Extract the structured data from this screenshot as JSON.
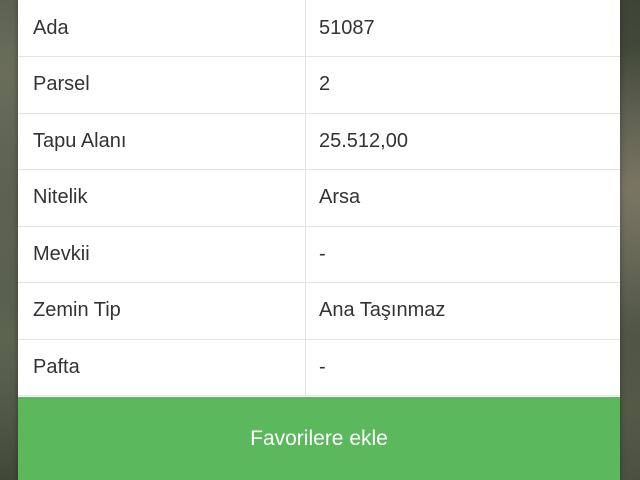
{
  "table": {
    "rows": [
      {
        "label": "Ada",
        "value": "51087"
      },
      {
        "label": "Parsel",
        "value": "2"
      },
      {
        "label": "Tapu Alanı",
        "value": "25.512,00"
      },
      {
        "label": "Nitelik",
        "value": "Arsa"
      },
      {
        "label": "Mevkii",
        "value": "-"
      },
      {
        "label": "Zemin Tip",
        "value": "Ana Taşınmaz"
      },
      {
        "label": "Pafta",
        "value": "-"
      }
    ]
  },
  "actions": {
    "favorite_label": "Favorilere ekle"
  },
  "colors": {
    "button_green": "#5cb85c",
    "text": "#333333",
    "border": "#e4e4e4"
  }
}
